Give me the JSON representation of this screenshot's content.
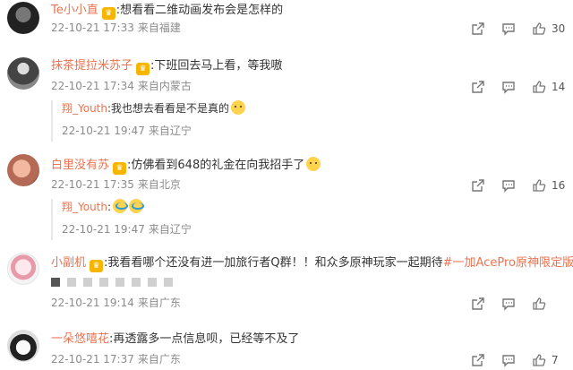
{
  "comments": [
    {
      "username": "Te小小直",
      "text": ":想看看二维动画发布会是怎样的",
      "date": "22-10-21 17:33",
      "location": "来自福建",
      "likes": "30"
    },
    {
      "username": "抹茶提拉米苏子",
      "text": ":下班回去马上看，等我嗷",
      "date": "22-10-21 17:34",
      "location": "来自内蒙古",
      "likes": "14",
      "reply": {
        "username": "翔_Youth",
        "text": ":我也想去看看是不是真的",
        "date": "22-10-21 19:47",
        "location": "来自辽宁"
      }
    },
    {
      "username": "白里没有苏",
      "text": ":仿佛看到648的礼金在向我招手了",
      "date": "22-10-21 17:35",
      "location": "来自北京",
      "likes": "16",
      "reply": {
        "username": "翔_Youth",
        "text": ":",
        "date": "22-10-21 19:47",
        "location": "来自辽宁"
      }
    },
    {
      "username": "小副机",
      "text": ":我看看哪个还没有进一加旅行者Q群！！和众多原神玩家一起期待",
      "hashtag": "#一加AcePro原神限定版#",
      "trail": " Q",
      "date": "22-10-21 19:14",
      "location": "来自广东",
      "likes": ""
    },
    {
      "username": "一朵悠嘻花",
      "text": ":再透露多一点信息呗，已经等不及了",
      "date": "22-10-21 17:37",
      "location": "来自广东",
      "likes": "7"
    }
  ],
  "icons": {
    "share": "share-icon",
    "comment": "comment-icon",
    "like": "thumbs-up-icon"
  },
  "colors": {
    "username": "#eb7350",
    "meta": "#8c8c8c",
    "badge": "#f7b500"
  }
}
